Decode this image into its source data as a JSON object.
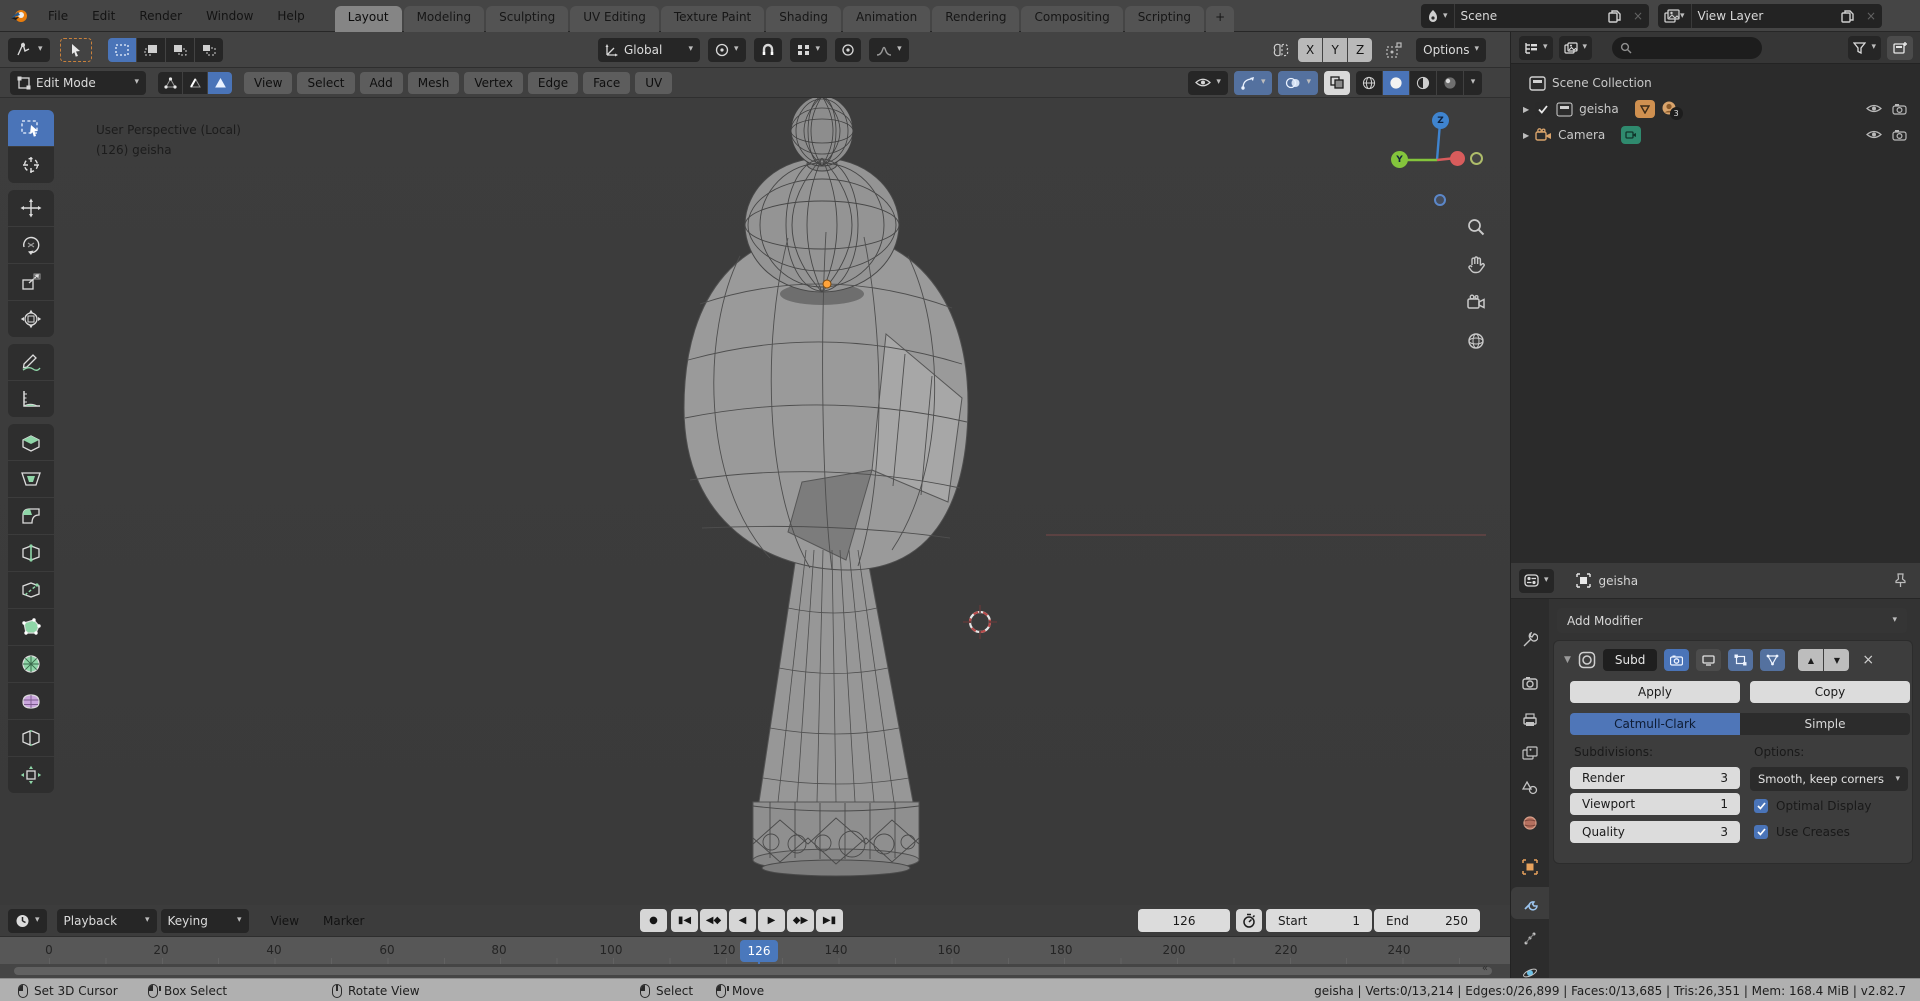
{
  "icons": {
    "chevron_down": "▾",
    "collapse_arrow": "▶",
    "expand_arrow": "▼",
    "arrow_up": "▲",
    "arrow_down": "▼",
    "close": "×",
    "scroll_end": "«"
  },
  "topbar": {
    "menus": [
      "File",
      "Edit",
      "Render",
      "Window",
      "Help"
    ],
    "tabs": [
      "Layout",
      "Modeling",
      "Sculpting",
      "UV Editing",
      "Texture Paint",
      "Shading",
      "Animation",
      "Rendering",
      "Compositing",
      "Scripting"
    ],
    "new_tab": "+",
    "scene": {
      "label": "Scene"
    },
    "view_layer": {
      "label": "View Layer"
    }
  },
  "tool_settings": {
    "orientation": "Global",
    "options_label": "Options",
    "mirror_axes": [
      "X",
      "Y",
      "Z"
    ]
  },
  "viewport": {
    "mode": "Edit Mode",
    "menus": [
      "View",
      "Select",
      "Add",
      "Mesh",
      "Vertex",
      "Edge",
      "Face",
      "UV"
    ],
    "overlay": {
      "line1": "User Perspective (Local)",
      "line2": "(126) geisha"
    },
    "gizmo_labels": {
      "z": "Z",
      "y": "Y"
    }
  },
  "outliner": {
    "rows": [
      {
        "label": "Scene Collection"
      },
      {
        "label": "geisha",
        "badge_count": "3"
      },
      {
        "label": "Camera"
      }
    ]
  },
  "properties": {
    "breadcrumb": "geisha",
    "add_modifier": "Add Modifier",
    "modifier": {
      "name": "Subd",
      "apply": "Apply",
      "copy": "Copy",
      "type_left": "Catmull-Clark",
      "type_right": "Simple",
      "subdivisions_label": "Subdivisions:",
      "options_label": "Options:",
      "fields": [
        {
          "label": "Render",
          "value": "3"
        },
        {
          "label": "Viewport",
          "value": "1"
        },
        {
          "label": "Quality",
          "value": "3"
        }
      ],
      "uv_smooth": "Smooth, keep corners",
      "checkboxes": [
        {
          "label": "Optimal Display"
        },
        {
          "label": "Use Creases"
        }
      ]
    }
  },
  "timeline": {
    "menus": [
      "Playback",
      "Keying",
      "View",
      "Marker"
    ],
    "transport": [
      "●",
      "▮◀",
      "◀◆",
      "◀",
      "▶",
      "◆▶",
      "▶▮"
    ],
    "current_frame": "126",
    "start_label": "Start",
    "start": "1",
    "end_label": "End",
    "end": "250",
    "ruler": [
      "0",
      "20",
      "40",
      "60",
      "80",
      "100",
      "120",
      "140",
      "160",
      "180",
      "200",
      "220",
      "240"
    ],
    "playhead": "126"
  },
  "status_bar": {
    "hints": [
      {
        "label": "Set 3D Cursor"
      },
      {
        "label": "Box Select"
      },
      {
        "label": "Rotate View"
      },
      {
        "label": "Select"
      },
      {
        "label": "Move"
      }
    ],
    "stats": "geisha | Verts:0/13,214 | Edges:0/26,899 | Faces:0/13,685 | Tris:26,351 | Mem: 168.4 MiB | v2.82.7"
  }
}
